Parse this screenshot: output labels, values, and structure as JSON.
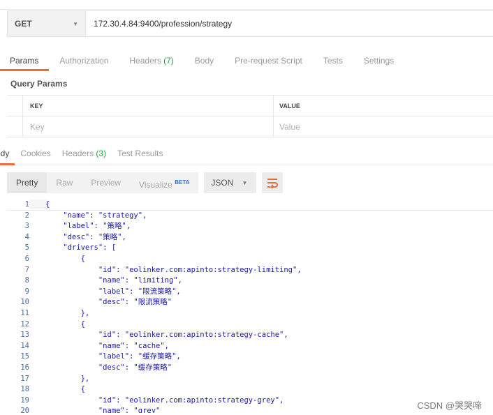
{
  "request": {
    "method": "GET",
    "url": "172.30.4.84:9400/profession/strategy"
  },
  "request_tabs": [
    {
      "label": "Params",
      "count": ""
    },
    {
      "label": "Authorization",
      "count": ""
    },
    {
      "label": "Headers ",
      "count": "(7)"
    },
    {
      "label": "Body",
      "count": ""
    },
    {
      "label": "Pre-request Script",
      "count": ""
    },
    {
      "label": "Tests",
      "count": ""
    },
    {
      "label": "Settings",
      "count": ""
    }
  ],
  "query_params": {
    "title": "Query Params",
    "key_header": "KEY",
    "value_header": "VALUE",
    "key_placeholder": "Key",
    "value_placeholder": "Value"
  },
  "response_tabs": [
    {
      "label": "ody",
      "count": ""
    },
    {
      "label": "Cookies",
      "count": ""
    },
    {
      "label": "Headers ",
      "count": "(3)"
    },
    {
      "label": "Test Results",
      "count": ""
    }
  ],
  "view": {
    "pretty": "Pretty",
    "raw": "Raw",
    "preview": "Preview",
    "visualize": "Visualize",
    "beta": "BETA",
    "format": "JSON"
  },
  "code_lines": [
    {
      "n": "1",
      "text": "{"
    },
    {
      "n": "2",
      "text": "    \"name\": \"strategy\","
    },
    {
      "n": "3",
      "text": "    \"label\": \"策略\","
    },
    {
      "n": "4",
      "text": "    \"desc\": \"策略\","
    },
    {
      "n": "5",
      "text": "    \"drivers\": ["
    },
    {
      "n": "6",
      "text": "        {"
    },
    {
      "n": "7",
      "text": "            \"id\": \"eolinker.com:apinto:strategy-limiting\","
    },
    {
      "n": "8",
      "text": "            \"name\": \"limiting\","
    },
    {
      "n": "9",
      "text": "            \"label\": \"限流策略\","
    },
    {
      "n": "10",
      "text": "            \"desc\": \"限流策略\""
    },
    {
      "n": "11",
      "text": "        },"
    },
    {
      "n": "12",
      "text": "        {"
    },
    {
      "n": "13",
      "text": "            \"id\": \"eolinker.com:apinto:strategy-cache\","
    },
    {
      "n": "14",
      "text": "            \"name\": \"cache\","
    },
    {
      "n": "15",
      "text": "            \"label\": \"缓存策略\","
    },
    {
      "n": "16",
      "text": "            \"desc\": \"缓存策略\""
    },
    {
      "n": "17",
      "text": "        },"
    },
    {
      "n": "18",
      "text": "        {"
    },
    {
      "n": "19",
      "text": "            \"id\": \"eolinker.com:apinto:strategy-grey\","
    },
    {
      "n": "20",
      "text": "            \"name\": \"grey\""
    }
  ],
  "watermark": "CSDN @哭哭啼",
  "colors": {
    "accent": "#f26b3a",
    "count_green": "#24a148",
    "code_text": "#1a1aa6",
    "line_number": "#4a6a9c",
    "beta_blue": "#2f73d8"
  }
}
